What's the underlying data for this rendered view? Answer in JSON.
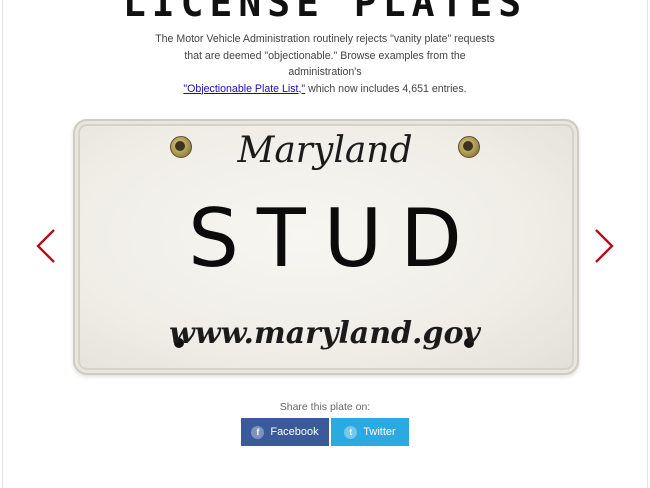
{
  "header": {
    "title": "LICENSE PLATES",
    "intro_line1": "The Motor Vehicle Administration routinely rejects \"vanity plate\" requests",
    "intro_line2": "that are deemed \"objectionable.\" Browse examples from the administration's",
    "intro_link": "\"Objectionable Plate List,\"",
    "intro_line3_rest": " which now includes 4,651 entries."
  },
  "plate": {
    "state": "Maryland",
    "text": "STUD",
    "website": "www.maryland.gov"
  },
  "carousel": {
    "prev_icon": "chevron-left-icon",
    "next_icon": "chevron-right-icon",
    "arrow_color": "#b0121d"
  },
  "share": {
    "label": "Share this plate on:",
    "facebook_label": "Facebook",
    "facebook_icon": "f",
    "twitter_label": "Twitter",
    "twitter_icon": "t",
    "facebook_color": "#3b5a9a",
    "twitter_color": "#2ba9e1"
  }
}
